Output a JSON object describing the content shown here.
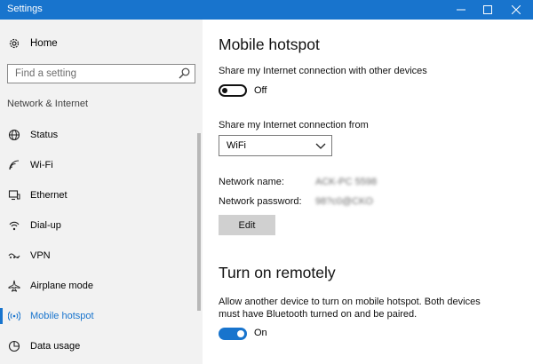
{
  "window": {
    "title": "Settings"
  },
  "sidebar": {
    "home_label": "Home",
    "search_placeholder": "Find a setting",
    "section_label": "Network & Internet",
    "items": [
      {
        "label": "Status",
        "icon": "globe-icon"
      },
      {
        "label": "Wi-Fi",
        "icon": "wifi-icon"
      },
      {
        "label": "Ethernet",
        "icon": "ethernet-icon"
      },
      {
        "label": "Dial-up",
        "icon": "dialup-icon"
      },
      {
        "label": "VPN",
        "icon": "vpn-icon"
      },
      {
        "label": "Airplane mode",
        "icon": "airplane-icon"
      },
      {
        "label": "Mobile hotspot",
        "icon": "hotspot-icon",
        "selected": true
      },
      {
        "label": "Data usage",
        "icon": "data-usage-icon"
      }
    ]
  },
  "main": {
    "title": "Mobile hotspot",
    "share_label": "Share my Internet connection with other devices",
    "share_toggle_state": "Off",
    "share_from_label": "Share my Internet connection from",
    "share_from_value": "WiFi",
    "network_name_label": "Network name:",
    "network_name_value": "ACK-PC 5598",
    "network_password_label": "Network password:",
    "network_password_value": "98?c0@CKO",
    "edit_button": "Edit",
    "remote_title": "Turn on remotely",
    "remote_desc_line1": "Allow another device to turn on mobile hotspot. Both devices",
    "remote_desc_line2": "must have Bluetooth turned on and be paired.",
    "remote_toggle_state": "On"
  },
  "colors": {
    "accent": "#1874cd",
    "sidebar_bg": "#f2f2f2"
  }
}
